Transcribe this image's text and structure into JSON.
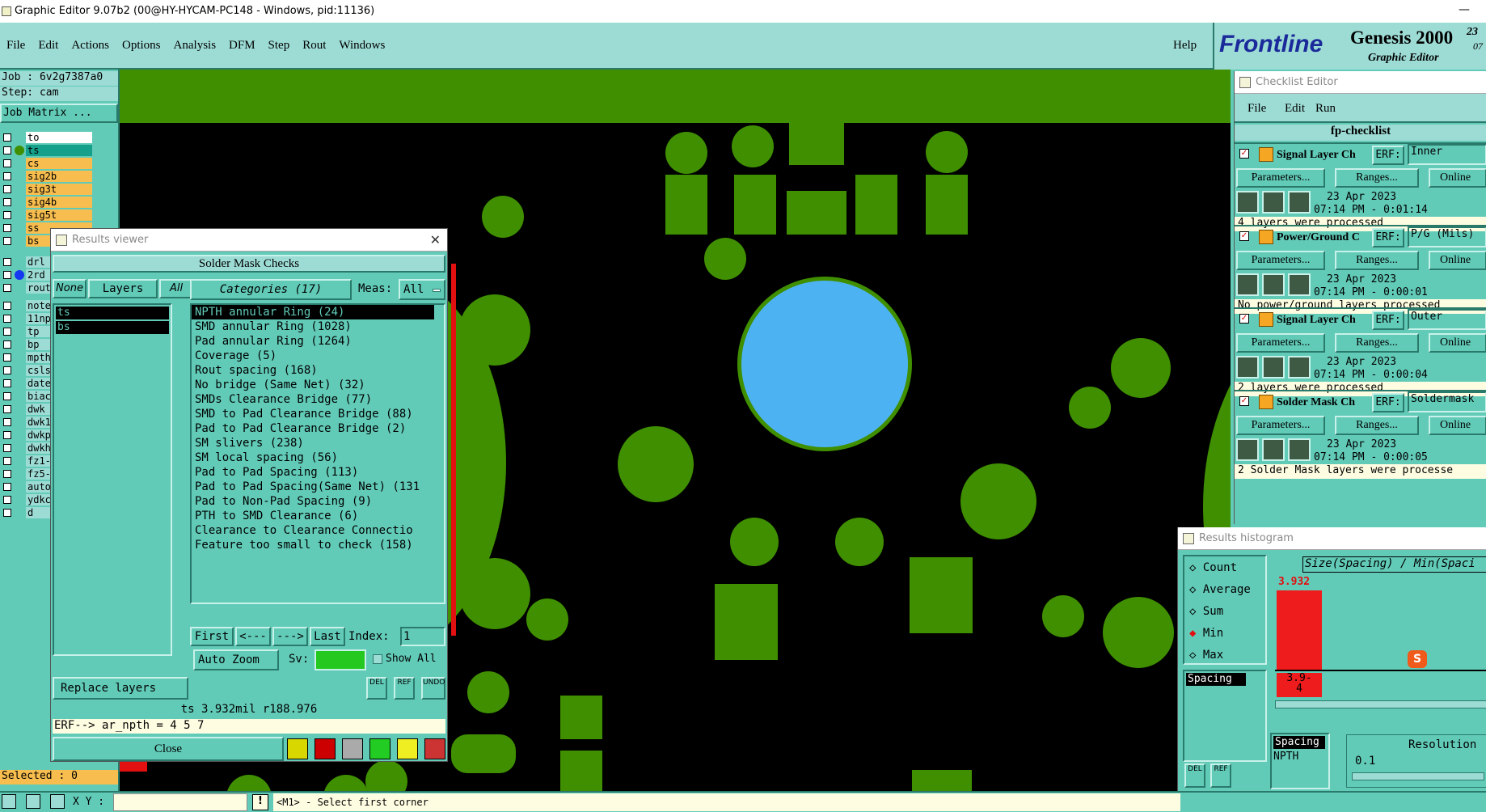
{
  "window": {
    "title": "Graphic Editor 9.07b2 (00@HY-HYCAM-PC148 - Windows, pid:11136)",
    "close": "—"
  },
  "menu": {
    "items": [
      "File",
      "Edit",
      "Actions",
      "Options",
      "Analysis",
      "DFM",
      "Step",
      "Rout",
      "Windows"
    ],
    "help": "Help"
  },
  "brand": {
    "logo": "Frontline",
    "product": "Genesis 2000",
    "subtitle": "Graphic Editor",
    "date_top": "23",
    "date_bottom": "07"
  },
  "job": {
    "job_label": "Job : 6v2g7387a0",
    "step_label": "Step: cam",
    "matrix_button": "Job Matrix ..."
  },
  "layers": {
    "group1": [
      "to",
      "ts",
      "cs",
      "sig2b",
      "sig3t",
      "sig4b",
      "sig5t",
      "ss",
      "bs"
    ],
    "group2": [
      "drl",
      "2rd",
      "rout"
    ],
    "group3": [
      "note",
      "11np",
      "tp",
      "bp",
      "mpth",
      "csls",
      "date",
      "biac",
      "dwk",
      "dwk1",
      "dwkp",
      "dwkh",
      "fz1-",
      "fz5-",
      "auto",
      "ydkc",
      "d"
    ]
  },
  "results_viewer": {
    "title": "Results viewer",
    "header": "Solder Mask Checks",
    "none": "None",
    "layers": "Layers",
    "all": "All",
    "categories_button": "Categories (17)",
    "meas_label": "Meas:",
    "meas_value": "All",
    "layer_list": [
      "ts",
      "bs"
    ],
    "categories": [
      "NPTH annular Ring (24)",
      "SMD annular Ring (1028)",
      "Pad annular Ring (1264)",
      "Coverage (5)",
      "Rout spacing (168)",
      "No bridge (Same Net) (32)",
      "SMDs Clearance Bridge (77)",
      "SMD to Pad Clearance Bridge (88)",
      "Pad to Pad Clearance Bridge (2)",
      "SM slivers (238)",
      "SM local spacing (56)",
      "Pad to Pad Spacing (113)",
      "Pad to Pad Spacing(Same Net) (131",
      "Pad to Non-Pad Spacing (9)",
      "PTH to SMD Clearance (6)",
      "Clearance to Clearance Connectio",
      "Feature too small to check (158)"
    ],
    "nav": {
      "first": "First",
      "prev": "<---",
      "next": "--->",
      "last": "Last",
      "index_label": "Index:",
      "index_value": "1"
    },
    "auto_zoom": "Auto Zoom",
    "sv_label": "Sv:",
    "show_all": "Show All",
    "replace_layers": "Replace layers",
    "del": "DEL",
    "ref": "REF",
    "undo": "UNDO",
    "status": "ts 3.932mil  r188.976",
    "erf": "ERF--> ar_npth = 4 5 7",
    "close": "Close"
  },
  "checklist": {
    "title": "Checklist Editor",
    "menu": [
      "File",
      "Edit",
      "Run"
    ],
    "name": "fp-checklist",
    "items": [
      {
        "label": "Signal Layer Ch",
        "erf": "ERF:",
        "erf_value": "Inner",
        "date": "23 Apr 2023",
        "time": "07:14 PM - 0:01:14",
        "msg": "4 layers were processed"
      },
      {
        "label": "Power/Ground C",
        "erf": "ERF:",
        "erf_value": "P/G (Mils)",
        "date": "23 Apr 2023",
        "time": "07:14 PM - 0:00:01",
        "msg": "No power/ground layers processed"
      },
      {
        "label": "Signal Layer Ch",
        "erf": "ERF:",
        "erf_value": "Outer",
        "date": "23 Apr 2023",
        "time": "07:14 PM - 0:00:04",
        "msg": "2 layers were processed"
      },
      {
        "label": "Solder Mask Ch",
        "erf": "ERF:",
        "erf_value": "Soldermask",
        "date": "23 Apr 2023",
        "time": "07:14 PM - 0:00:05",
        "msg": "2 Solder Mask layers were processe"
      }
    ],
    "parameters": "Parameters...",
    "ranges": "Ranges...",
    "online": "Online"
  },
  "histogram": {
    "title": "Results histogram",
    "options": [
      "Count",
      "Average",
      "Sum",
      "Min",
      "Max"
    ],
    "selected": "Min",
    "header": "Size(Spacing) / Min(Spaci",
    "bar_value": "3.932",
    "bar_label_1": "3.9-",
    "bar_label_2": "4",
    "list_item": "Spacing",
    "sel_1": "Spacing",
    "sel_2": "NPTH",
    "resolution_label": "Resolution",
    "resolution_value": "0.1",
    "del": "DEL",
    "ref": "REF"
  },
  "bottom": {
    "selected": "Selected : 0",
    "xy_label": "X Y :",
    "prompt": "<M1> - Select first corner"
  },
  "colors": {
    "teal": "#62cbb8",
    "pcb_green": "#3f8f00",
    "hole_blue": "#4db2f2",
    "layer_orange": "#f7bd4e",
    "hist_red": "#ee1c1c"
  }
}
